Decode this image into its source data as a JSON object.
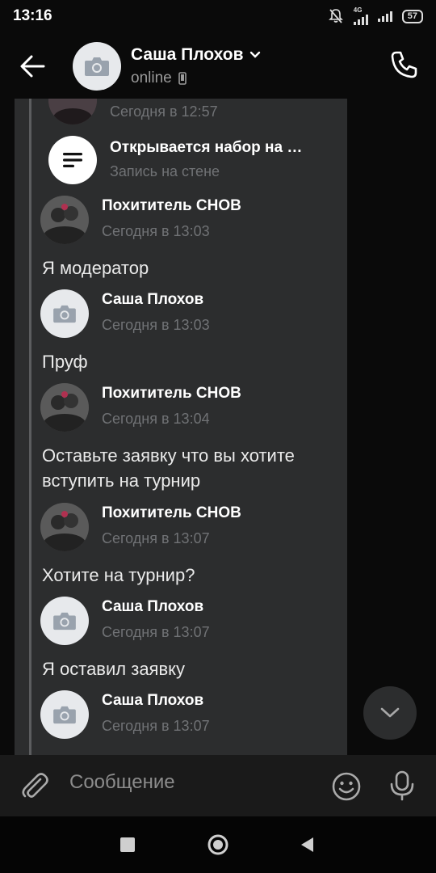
{
  "status_bar": {
    "time": "13:16",
    "network": "4G",
    "battery": "57"
  },
  "header": {
    "name": "Саша Плохов",
    "status": "online"
  },
  "partial_item": {
    "time": "Сегодня в 12:57"
  },
  "wall_post": {
    "title": "Открывается набор на …",
    "subtitle": "Запись на стене"
  },
  "messages": [
    {
      "sender": "Похититель СНОВ",
      "time": "Сегодня в 13:03",
      "text": "Я модератор"
    },
    {
      "sender": "Саша Плохов",
      "time": "Сегодня в 13:03",
      "text": "Пруф"
    },
    {
      "sender": "Похититель СНОВ",
      "time": "Сегодня в 13:04",
      "text": "Оставьте заявку что вы хотите вступить на турнир"
    },
    {
      "sender": "Похититель СНОВ",
      "time": "Сегодня в 13:07",
      "text": "Хотите на турнир?"
    },
    {
      "sender": "Саша Плохов",
      "time": "Сегодня в 13:07",
      "text": "Я оставил заявку"
    },
    {
      "sender": "Саша Плохов",
      "time": "Сегодня в 13:07",
      "text": ""
    }
  ],
  "composer": {
    "placeholder": "Сообщение"
  },
  "icons": {
    "back": "arrow-left-icon",
    "phone": "phone-icon",
    "camera": "camera-icon",
    "wall": "wall-post-icon",
    "chevron": "chevron-down-icon",
    "attach": "paperclip-icon",
    "emoji": "smile-icon",
    "mic": "microphone-icon"
  },
  "colors": {
    "bubble_bg": "#2c2d2e",
    "background": "#0a0a0a",
    "secondary_text": "#707275"
  }
}
